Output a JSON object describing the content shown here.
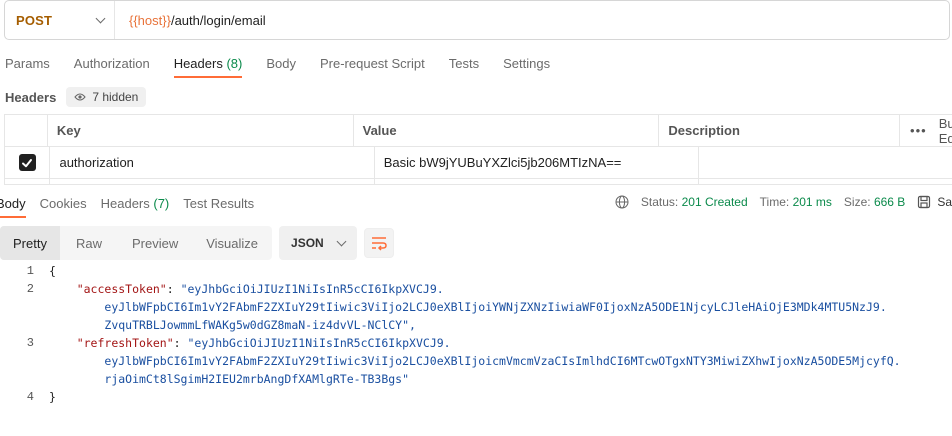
{
  "request": {
    "method": "POST",
    "url_var": "{{host}}",
    "url_path": "/auth/login/email"
  },
  "request_tabs": [
    {
      "label": "Params",
      "count": ""
    },
    {
      "label": "Authorization",
      "count": ""
    },
    {
      "label": "Headers",
      "count": "(8)"
    },
    {
      "label": "Body",
      "count": ""
    },
    {
      "label": "Pre-request Script",
      "count": ""
    },
    {
      "label": "Tests",
      "count": ""
    },
    {
      "label": "Settings",
      "count": ""
    }
  ],
  "headers_section": {
    "title": "Headers",
    "hidden_label": "7 hidden"
  },
  "headers_table": {
    "columns": {
      "key": "Key",
      "value": "Value",
      "description": "Description",
      "bulk": "Bulk Ed"
    },
    "rows": [
      {
        "checked": true,
        "key": "authorization",
        "value": "Basic bW9jYUBuYXZlci5jb206MTIzNA==",
        "description": ""
      }
    ]
  },
  "response_tabs": [
    {
      "label": "Body",
      "count": ""
    },
    {
      "label": "Cookies",
      "count": ""
    },
    {
      "label": "Headers",
      "count": "(7)"
    },
    {
      "label": "Test Results",
      "count": ""
    }
  ],
  "response_status": {
    "status_label": "Status:",
    "status_value": "201 Created",
    "time_label": "Time:",
    "time_value": "201 ms",
    "size_label": "Size:",
    "size_value": "666 B",
    "save_label": "Sa"
  },
  "view_modes": [
    "Pretty",
    "Raw",
    "Preview",
    "Visualize"
  ],
  "format_select": "JSON",
  "code_lines": {
    "n1": "1",
    "n2": "2",
    "n3": "3",
    "n4": "4",
    "open_brace": "{",
    "close_brace": "}",
    "access_key": "\"accessToken\"",
    "access_v1": "\"eyJhbGciOiJIUzI1NiIsInR5cCI6IkpXVCJ9.",
    "access_v2": "eyJlbWFpbCI6Im1vY2FAbmF2ZXIuY29tIiwic3ViIjo2LCJ0eXBlIjoiYWNjZXNzIiwiaWF0IjoxNzA5ODE1NjcyLCJleHAiOjE3MDk4MTU5NzJ9.",
    "access_v3": "ZvquTRBLJowmmLfWAKg5w0dGZ8maN-iz4dvVL-NClCY\",",
    "refresh_key": "\"refreshToken\"",
    "refresh_v1": "\"eyJhbGciOiJIUzI1NiIsInR5cCI6IkpXVCJ9.",
    "refresh_v2": "eyJlbWFpbCI6Im1vY2FAbmF2ZXIuY29tIiwic3ViIjo2LCJ0eXBlIjoicmVmcmVzaCIsImlhdCI6MTcwOTgxNTY3MiwiZXhwIjoxNzA5ODE5MjcyfQ.",
    "refresh_v3": "rjaOimCt8lSgimH2IEU2mrbAngDfXAMlgRTe-TB3Bgs\""
  }
}
